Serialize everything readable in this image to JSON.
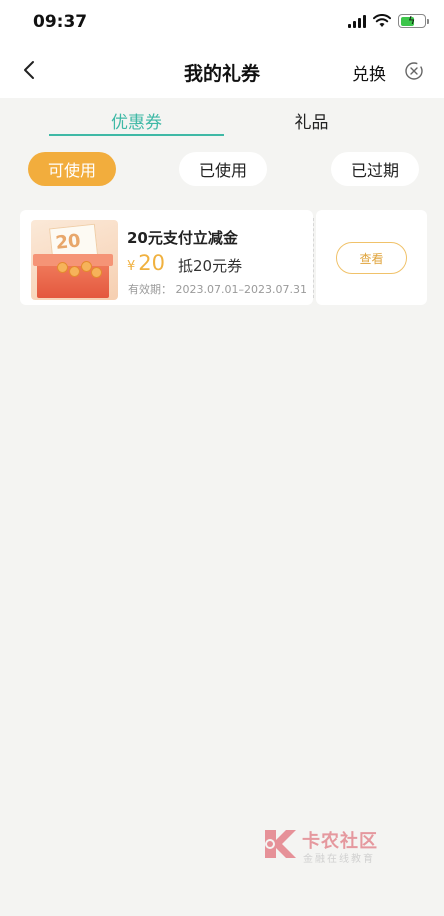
{
  "status_bar": {
    "time": "09:37"
  },
  "navbar": {
    "title": "我的礼券",
    "exchange_label": "兑换"
  },
  "tabs": [
    {
      "label": "优惠券",
      "active": true
    },
    {
      "label": "礼品",
      "active": false
    }
  ],
  "filters": [
    {
      "label": "可使用",
      "active": true
    },
    {
      "label": "已使用",
      "active": false
    },
    {
      "label": "已过期",
      "active": false
    }
  ],
  "coupons": [
    {
      "thumb_number": "20",
      "title": "20元支付立减金",
      "currency": "¥",
      "amount": "20",
      "description": "抵20元券",
      "validity": "有效期：  2023.07.01–2023.07.31",
      "action_label": "查看"
    }
  ],
  "watermark": {
    "logo_text": "卡农社区",
    "sub_text": "金融在线教育"
  },
  "colors": {
    "accent_teal": "#3fb9a6",
    "accent_orange": "#f2ad3d",
    "price_gold": "#f0b13f",
    "background": "#f4f4f2"
  }
}
